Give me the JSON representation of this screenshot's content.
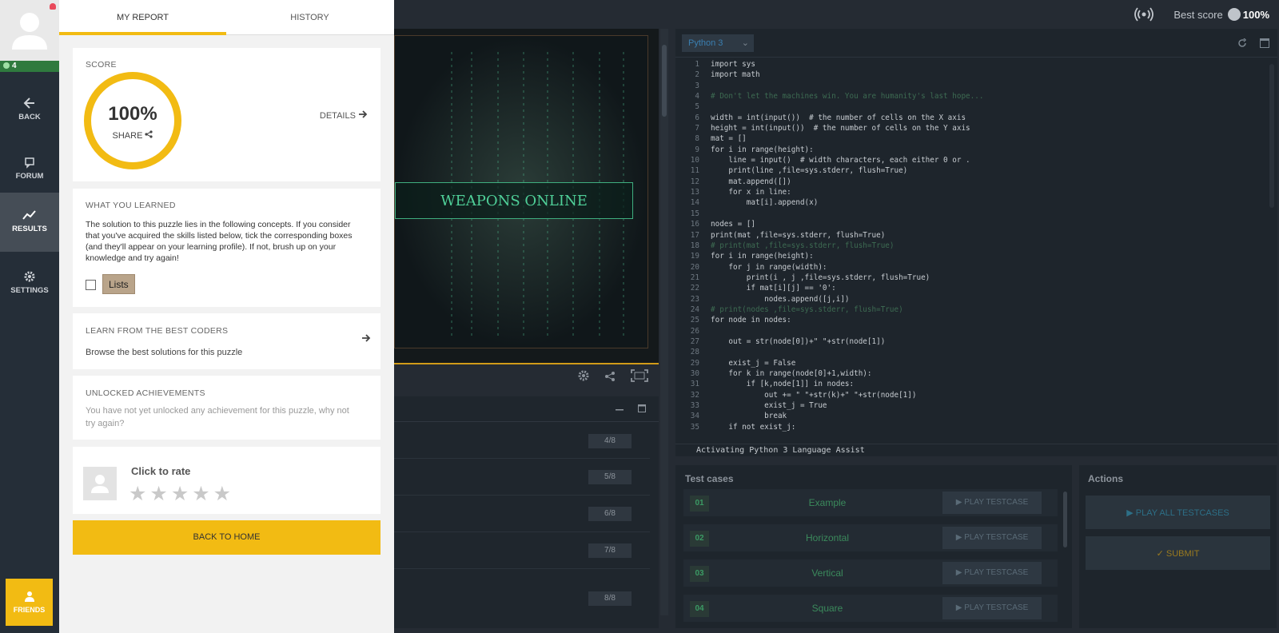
{
  "nav": {
    "level": "4",
    "back": "BACK",
    "forum": "FORUM",
    "results": "RESULTS",
    "settings": "SETTINGS",
    "friends": "FRIENDS"
  },
  "report": {
    "tabs": [
      "MY REPORT",
      "HISTORY"
    ],
    "score_title": "SCORE",
    "score_value": "100%",
    "share": "SHARE",
    "details": "DETAILS",
    "learned_title": "WHAT YOU LEARNED",
    "learned_text": "The solution to this puzzle lies in the following concepts. If you consider that you've acquired the skills listed below, tick the corresponding boxes (and they'll appear on your learning profile). If not, brush up on your knowledge and try again!",
    "skill": "Lists",
    "best_title": "LEARN FROM THE BEST CODERS",
    "best_text": "Browse the best solutions for this puzzle",
    "ach_title": "UNLOCKED ACHIEVEMENTS",
    "ach_text": "You have not yet unlocked any achievement for this puzzle, why not try again?",
    "rate_label": "Click to rate",
    "stars": "★★★★★",
    "home_button": "BACK TO HOME"
  },
  "header": {
    "best_score_label": "Best score",
    "best_score_value": "100%"
  },
  "viewer": {
    "banner": "WEAPONS ONLINE"
  },
  "results_list": {
    "badges": [
      "4/8",
      "5/8",
      "6/8",
      "7/8",
      "8/8"
    ]
  },
  "editor": {
    "language": "Python 3",
    "lines": [
      {
        "n": "1",
        "t": "import sys"
      },
      {
        "n": "2",
        "t": "import math"
      },
      {
        "n": "3",
        "t": ""
      },
      {
        "n": "4",
        "t": "# Don't let the machines win. You are humanity's last hope..."
      },
      {
        "n": "5",
        "t": ""
      },
      {
        "n": "6",
        "t": "width = int(input())  # the number of cells on the X axis"
      },
      {
        "n": "7",
        "t": "height = int(input())  # the number of cells on the Y axis"
      },
      {
        "n": "8",
        "t": "mat = []"
      },
      {
        "n": "9",
        "t": "for i in range(height):"
      },
      {
        "n": "10",
        "t": "    line = input()  # width characters, each either 0 or ."
      },
      {
        "n": "11",
        "t": "    print(line ,file=sys.stderr, flush=True)"
      },
      {
        "n": "12",
        "t": "    mat.append([])"
      },
      {
        "n": "13",
        "t": "    for x in line:"
      },
      {
        "n": "14",
        "t": "        mat[i].append(x)"
      },
      {
        "n": "15",
        "t": ""
      },
      {
        "n": "16",
        "t": "nodes = []"
      },
      {
        "n": "17",
        "t": "print(mat ,file=sys.stderr, flush=True)"
      },
      {
        "n": "18",
        "t": "# print(mat ,file=sys.stderr, flush=True)"
      },
      {
        "n": "19",
        "t": "for i in range(height):"
      },
      {
        "n": "20",
        "t": "    for j in range(width):"
      },
      {
        "n": "21",
        "t": "        print(i , j ,file=sys.stderr, flush=True)"
      },
      {
        "n": "22",
        "t": "        if mat[i][j] == '0':"
      },
      {
        "n": "23",
        "t": "            nodes.append([j,i])"
      },
      {
        "n": "24",
        "t": "# print(nodes ,file=sys.stderr, flush=True)"
      },
      {
        "n": "25",
        "t": "for node in nodes:"
      },
      {
        "n": "26",
        "t": ""
      },
      {
        "n": "27",
        "t": "    out = str(node[0])+\" \"+str(node[1])"
      },
      {
        "n": "28",
        "t": ""
      },
      {
        "n": "29",
        "t": "    exist_j = False"
      },
      {
        "n": "30",
        "t": "    for k in range(node[0]+1,width):"
      },
      {
        "n": "31",
        "t": "        if [k,node[1]] in nodes:"
      },
      {
        "n": "32",
        "t": "            out += \" \"+str(k)+\" \"+str(node[1])"
      },
      {
        "n": "33",
        "t": "            exist_j = True"
      },
      {
        "n": "34",
        "t": "            break"
      },
      {
        "n": "35",
        "t": "    if not exist_j:"
      }
    ],
    "assist": "Activating Python 3 Language Assist"
  },
  "tests": {
    "title": "Test cases",
    "play_label": "▶ PLAY TESTCASE",
    "cases": [
      {
        "num": "01",
        "name": "Example"
      },
      {
        "num": "02",
        "name": "Horizontal"
      },
      {
        "num": "03",
        "name": "Vertical"
      },
      {
        "num": "04",
        "name": "Square"
      }
    ]
  },
  "actions": {
    "title": "Actions",
    "play_all": "▶  PLAY ALL TESTCASES",
    "submit": "✓  SUBMIT"
  },
  "colors": {
    "accent": "#f2bb13",
    "panel_bg": "#f2f2f2",
    "nav_bg": "#252e38",
    "app_bg": "#252b33"
  }
}
